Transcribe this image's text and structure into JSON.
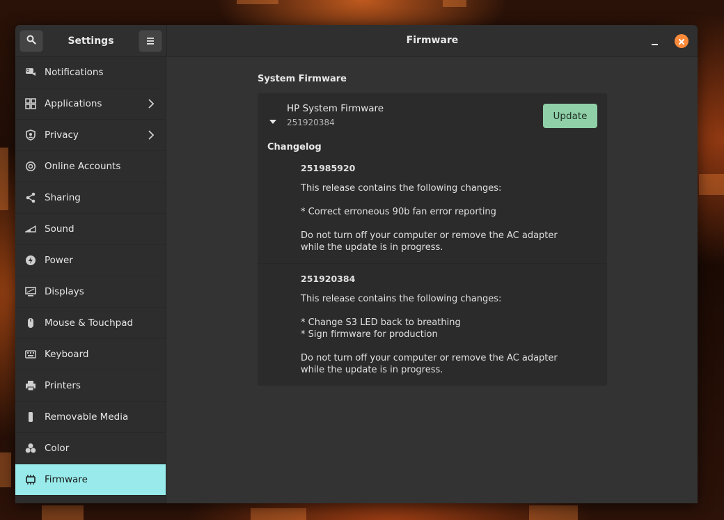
{
  "window": {
    "sidebar_title": "Settings",
    "main_title": "Firmware"
  },
  "colors": {
    "accent_active": "#99ebeb",
    "update_button": "#8fd0a8",
    "close_button": "#fb8a3a"
  },
  "sidebar": {
    "items": [
      {
        "label": "Notifications",
        "icon": "notifications-icon",
        "has_chevron": false
      },
      {
        "label": "Applications",
        "icon": "applications-icon",
        "has_chevron": true
      },
      {
        "label": "Privacy",
        "icon": "privacy-icon",
        "has_chevron": true
      },
      {
        "label": "Online Accounts",
        "icon": "online-accounts-icon",
        "has_chevron": false
      },
      {
        "label": "Sharing",
        "icon": "sharing-icon",
        "has_chevron": false
      },
      {
        "label": "Sound",
        "icon": "sound-icon",
        "has_chevron": false
      },
      {
        "label": "Power",
        "icon": "power-icon",
        "has_chevron": false
      },
      {
        "label": "Displays",
        "icon": "displays-icon",
        "has_chevron": false
      },
      {
        "label": "Mouse & Touchpad",
        "icon": "mouse-icon",
        "has_chevron": false
      },
      {
        "label": "Keyboard",
        "icon": "keyboard-icon",
        "has_chevron": false
      },
      {
        "label": "Printers",
        "icon": "printer-icon",
        "has_chevron": false
      },
      {
        "label": "Removable Media",
        "icon": "removable-media-icon",
        "has_chevron": false
      },
      {
        "label": "Color",
        "icon": "color-icon",
        "has_chevron": false
      },
      {
        "label": "Firmware",
        "icon": "firmware-icon",
        "has_chevron": false,
        "active": true
      }
    ]
  },
  "firmware": {
    "section_title": "System Firmware",
    "device_name": "HP System Firmware",
    "device_version": "251920384",
    "update_label": "Update",
    "changelog_title": "Changelog",
    "releases": [
      {
        "version": "251985920",
        "intro": "This release contains the following changes:",
        "changes": "* Correct erroneous 90b fan error reporting",
        "warning": "Do not turn off your computer or remove the AC adapter\nwhile the update is in progress."
      },
      {
        "version": "251920384",
        "intro": "This release contains the following changes:",
        "changes": "* Change S3 LED back to breathing\n* Sign firmware for production",
        "warning": "Do not turn off your computer or remove the AC adapter\nwhile the update is in progress."
      }
    ]
  }
}
